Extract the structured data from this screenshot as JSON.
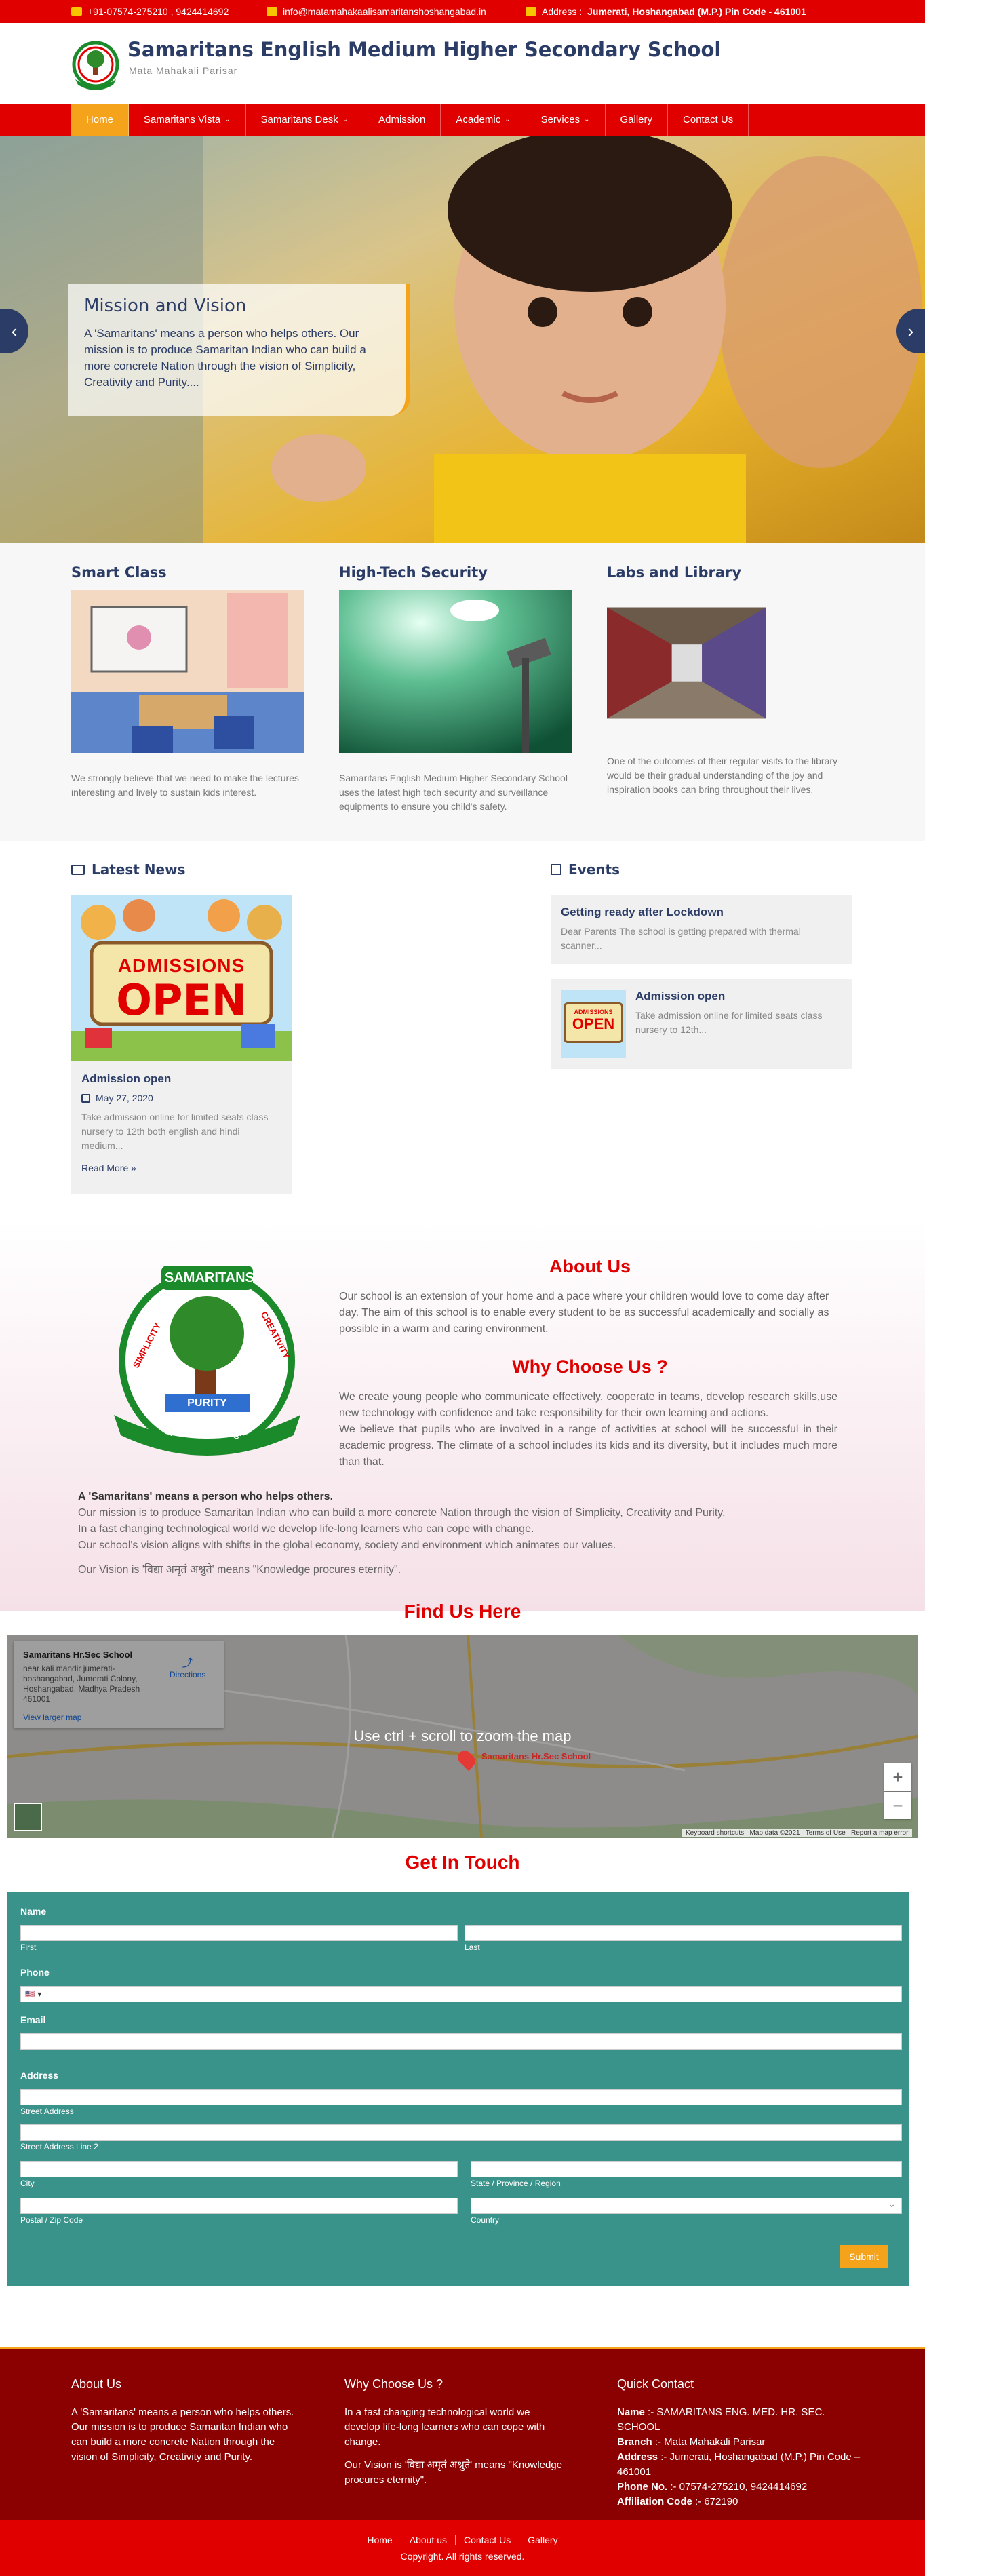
{
  "colors": {
    "primary": "#e00000",
    "accent": "#f5a31a",
    "navy": "#2b3c66",
    "teal": "#3a938a",
    "footer": "#8b0000"
  },
  "topbar": {
    "phone": "+91-07574-275210 , 9424414692",
    "email": "info@matamahakaalisamaritanshoshangabad.in",
    "address_label": "Address :",
    "address": "Jumerati, Hoshangabad (M.P.) Pin Code - 461001"
  },
  "header": {
    "title": "Samaritans English Medium Higher Secondary School",
    "tagline": "Mata Mahakali Parisar"
  },
  "nav": [
    {
      "label": "Home",
      "active": true
    },
    {
      "label": "Samaritans Vista",
      "dropdown": true
    },
    {
      "label": "Samaritans Desk",
      "dropdown": true
    },
    {
      "label": "Admission"
    },
    {
      "label": "Academic",
      "dropdown": true
    },
    {
      "label": "Services",
      "dropdown": true
    },
    {
      "label": "Gallery"
    },
    {
      "label": "Contact Us"
    }
  ],
  "hero": {
    "title": "Mission and Vision",
    "text": "A 'Samaritans' means a person who helps others. Our mission is to produce Samaritan Indian who can build a more concrete Nation through the vision of Simplicity, Creativity and Purity....",
    "prev": "‹",
    "next": "›"
  },
  "features": [
    {
      "title": "Smart Class",
      "text": "We strongly believe that we need to make the lectures interesting and lively to sustain kids interest."
    },
    {
      "title": "High-Tech Security",
      "text": "Samaritans English Medium Higher Secondary School uses the latest high tech security and surveillance equipments to ensure you child's safety."
    },
    {
      "title": "Labs and Library",
      "text": "One of the outcomes of their regular visits to the library would be their gradual understanding of the joy and inspiration books can bring throughout their lives."
    }
  ],
  "news": {
    "heading": "Latest News",
    "image_text": "ADMISSIONS",
    "image_text2": "OPEN",
    "title": "Admission open",
    "date": "May 27, 2020",
    "excerpt": "Take admission online for limited seats class nursery to 12th both english and hindi medium...",
    "read_more": "Read More »"
  },
  "events": {
    "heading": "Events",
    "items": [
      {
        "title": "Getting ready after Lockdown",
        "text": "Dear Parents The school is getting prepared with thermal scanner..."
      },
      {
        "title": "Admission open",
        "text": "Take admission online for limited seats class nursery to 12th...",
        "thumb1": "ADMISSIONS",
        "thumb2": "OPEN"
      }
    ]
  },
  "about": {
    "logo_top": "SAMARITANS",
    "logo_left": "SIMPLICITY",
    "logo_right": "CREATIVITY",
    "logo_bottom": "PURITY",
    "logo_motto": "विद्या अमृतम् अश्नुते",
    "heading": "About Us",
    "text": "Our school is an extension of your home and a pace where your children would love to come day after day. The aim of this school is to enable every student to be as successful academically and socially as possible in a warm and caring environment.",
    "why_heading": "Why Choose Us ?",
    "why_text1": "We create young people who communicate effectively, cooperate in teams, develop research skills,use new technology with confidence and take responsibility for their own learning and actions.",
    "why_text2": "We believe that pupils who are involved in a range of activities at school will be successful in their academic progress. The climate of a school includes its kids and its diversity, but it includes much more than that.",
    "samaritans_bold": "A 'Samaritans' means a person who helps others.",
    "samaritans_l1": "Our mission is to produce Samaritan Indian who can build a more concrete Nation through the vision of Simplicity, Creativity and Purity.",
    "samaritans_l2": "In a fast changing technological world we develop life-long learners who can cope with change.",
    "samaritans_l3": "Our school's vision aligns with shifts in the global economy, society and environment which animates our values.",
    "vision": "Our Vision is 'विद्या अमृतं अश्नुते' means \"Knowledge procures eternity\"."
  },
  "map": {
    "heading": "Find Us Here",
    "place_name": "Samaritans Hr.Sec School",
    "place_address": "near kali mandir jumerati-hoshangabad, Jumerati Colony, Hoshangabad, Madhya Pradesh 461001",
    "directions": "Directions",
    "view_larger": "View larger map",
    "overlay": "Use ctrl + scroll to zoom the map",
    "marker_label": "Samaritans Hr.Sec School",
    "zoom_in": "+",
    "zoom_out": "−",
    "attribution": "Keyboard shortcuts   Map data ©2021   Terms of Use   Report a map error"
  },
  "form": {
    "heading": "Get In Touch",
    "name": "Name",
    "first": "First",
    "last": "Last",
    "phone": "Phone",
    "flag": "🇺🇸 ▾",
    "email": "Email",
    "address": "Address",
    "street": "Street Address",
    "street2": "Street Address Line 2",
    "city": "City",
    "state": "State / Province / Region",
    "zip": "Postal / Zip Code",
    "country": "Country",
    "submit": "Submit"
  },
  "footer": {
    "about_heading": "About Us",
    "about_text": "A 'Samaritans' means a person who helps others. Our mission is to produce Samaritan Indian who can build a more concrete Nation through the vision of Simplicity, Creativity and Purity.",
    "why_heading": "Why Choose Us ?",
    "why_text1": "In a fast changing technological world we develop life-long learners who can cope with change.",
    "why_text2": "Our Vision is 'विद्या अमृतं अश्नुते' means \"Knowledge procures eternity\".",
    "contact_heading": "Quick Contact",
    "name_label": "Name",
    ":": ":",
    "name_value": " :- SAMARITANS ENG. MED. HR. SEC. SCHOOL",
    "branch_label": "Branch",
    "branch_value": " :- Mata Mahakali Parisar",
    "address_label": "Address",
    "address_value": " :- Jumerati, Hoshangabad (M.P.) Pin Code – 461001",
    "phone_label": "Phone No.",
    "phone_value": " :- 07574-275210, 9424414692",
    "affil_label": "Affiliation Code",
    "affil_value": " :- 672190",
    "links": [
      "Home",
      "About us",
      "Contact Us",
      "Gallery"
    ],
    "copyright": "Copyright. All rights reserved."
  }
}
